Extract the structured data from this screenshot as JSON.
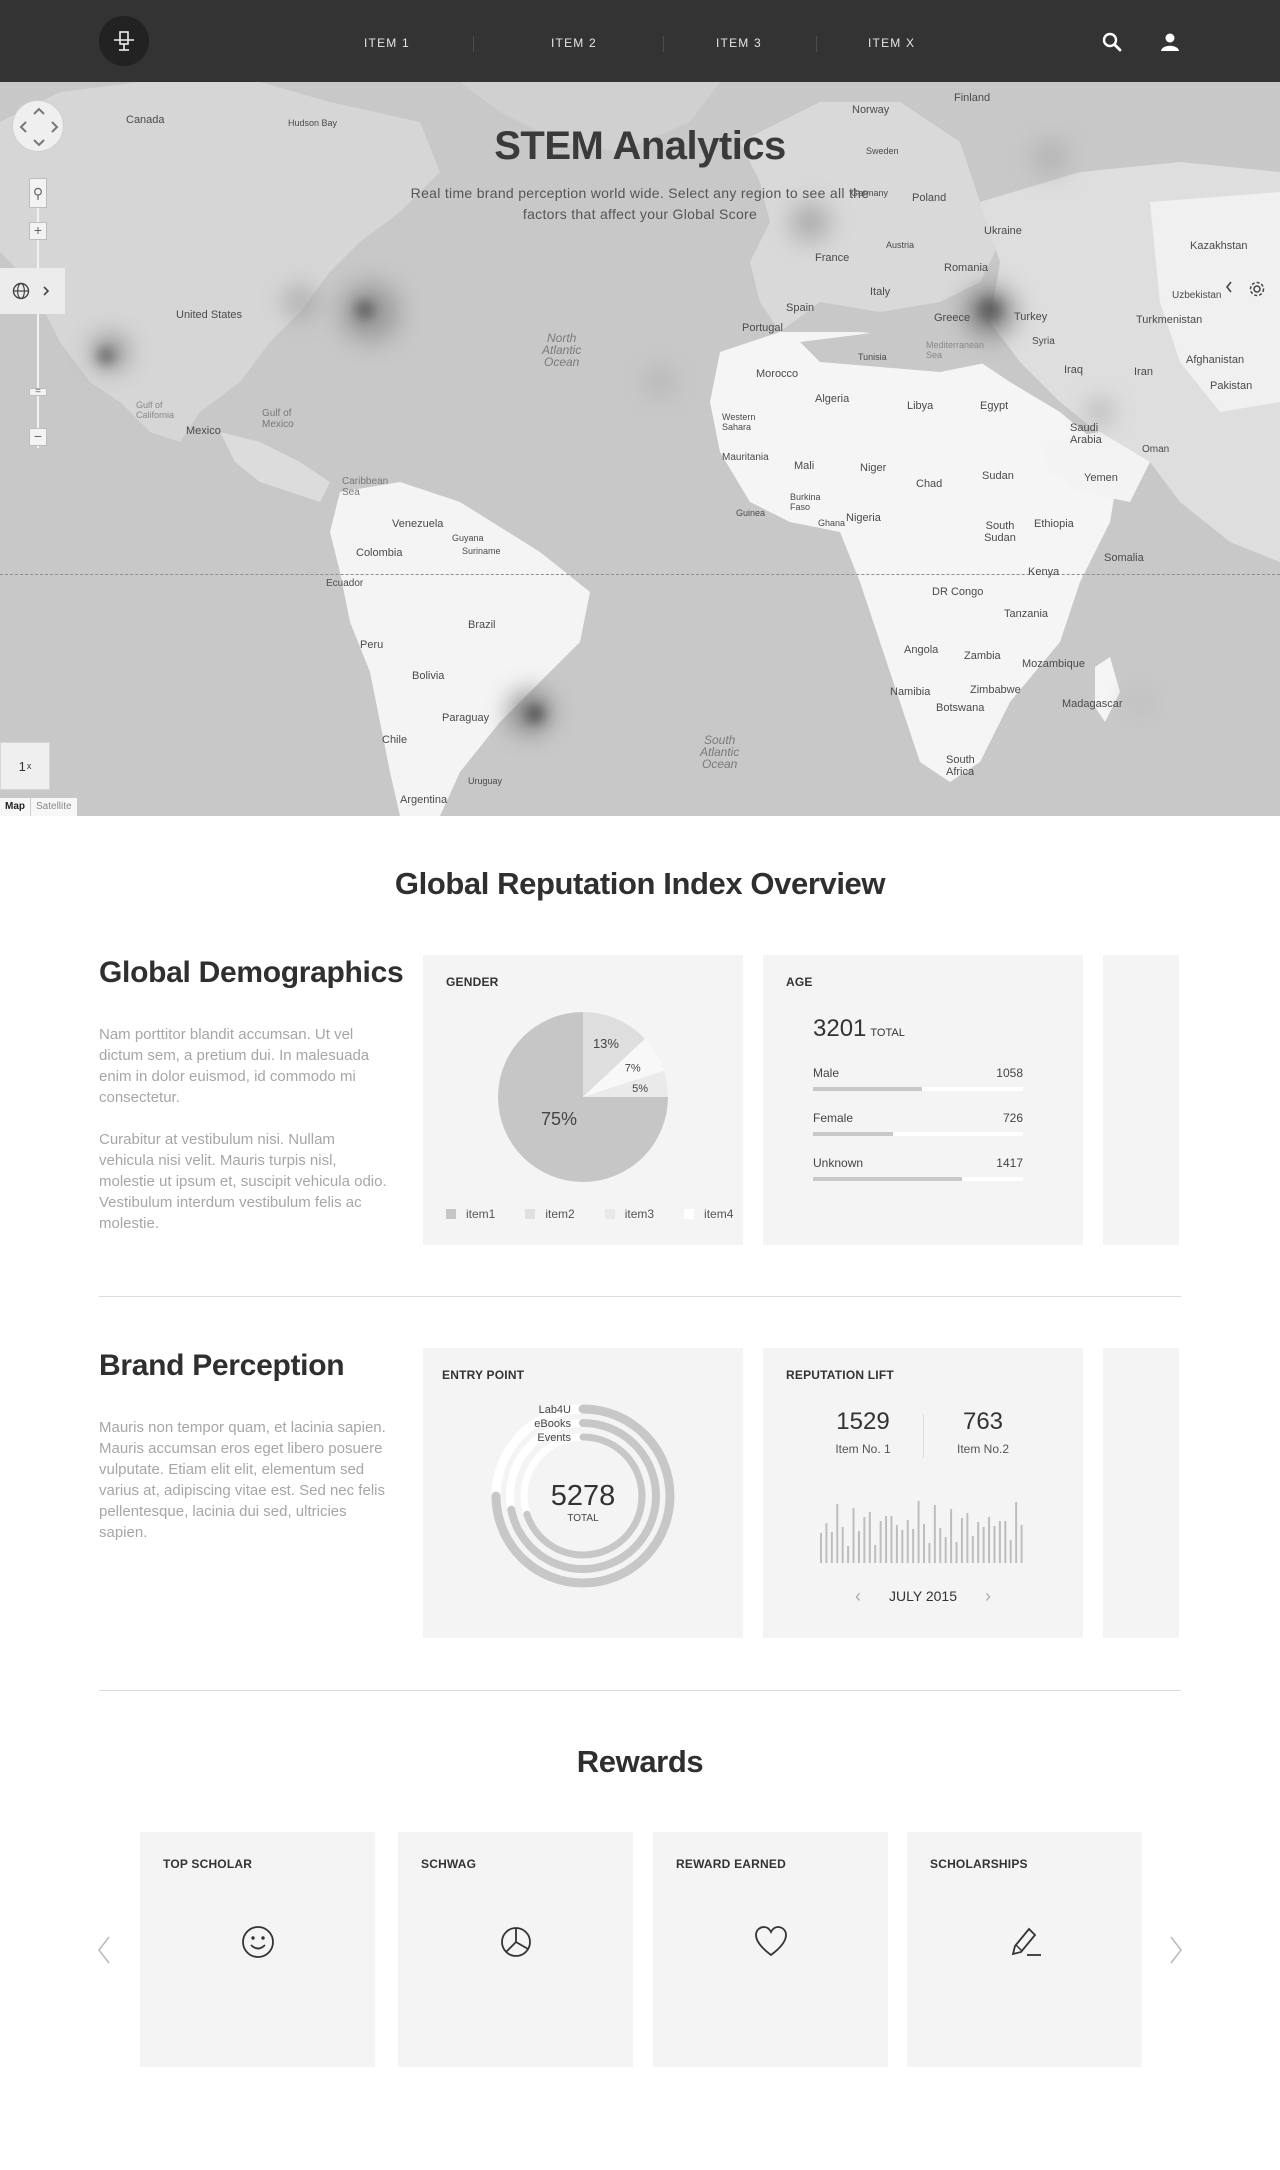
{
  "nav": {
    "items": [
      {
        "label": "ITEM 1"
      },
      {
        "label": "ITEM 2"
      },
      {
        "label": "ITEM 3"
      },
      {
        "label": "ITEM X"
      }
    ],
    "icons": {
      "logo": "logo-icon",
      "search": "search-icon",
      "user": "user-icon"
    }
  },
  "hero": {
    "title": "STEM Analytics",
    "subtitle": "Real time brand perception world wide. Select any region to see all the factors that affect your Global Score"
  },
  "map": {
    "speed_label": "1",
    "speed_unit": "x",
    "type_map": "Map",
    "type_satellite": "Satellite",
    "labels": [
      {
        "text": "Canada"
      },
      {
        "text": "Hudson Bay"
      },
      {
        "text": "United States"
      },
      {
        "text": "Mexico"
      },
      {
        "text": "Gulf of Mexico"
      },
      {
        "text": "Caribbean Sea"
      },
      {
        "text": "Venezuela"
      },
      {
        "text": "Colombia"
      },
      {
        "text": "Guyana"
      },
      {
        "text": "Suriname"
      },
      {
        "text": "Ecuador"
      },
      {
        "text": "Peru"
      },
      {
        "text": "Brazil"
      },
      {
        "text": "Bolivia"
      },
      {
        "text": "Paraguay"
      },
      {
        "text": "Chile"
      },
      {
        "text": "Argentina"
      },
      {
        "text": "Uruguay"
      },
      {
        "text": "Finland"
      },
      {
        "text": "Norway"
      },
      {
        "text": "Sweden"
      },
      {
        "text": "Poland"
      },
      {
        "text": "Ukraine"
      },
      {
        "text": "Germany"
      },
      {
        "text": "France"
      },
      {
        "text": "Spain"
      },
      {
        "text": "Portugal"
      },
      {
        "text": "Italy"
      },
      {
        "text": "Austria"
      },
      {
        "text": "Romania"
      },
      {
        "text": "Greece"
      },
      {
        "text": "Turkey"
      },
      {
        "text": "Kazakhstan"
      },
      {
        "text": "Uzbekistan"
      },
      {
        "text": "Turkmenistan"
      },
      {
        "text": "Afghanistan"
      },
      {
        "text": "Pakistan"
      },
      {
        "text": "Iraq"
      },
      {
        "text": "Iran"
      },
      {
        "text": "Syria"
      },
      {
        "text": "Saudi Arabia"
      },
      {
        "text": "Oman"
      },
      {
        "text": "Yemen"
      },
      {
        "text": "Egypt"
      },
      {
        "text": "Libya"
      },
      {
        "text": "Tunisia"
      },
      {
        "text": "Morocco"
      },
      {
        "text": "Algeria"
      },
      {
        "text": "Western Sahara"
      },
      {
        "text": "Mauritania"
      },
      {
        "text": "Mali"
      },
      {
        "text": "Niger"
      },
      {
        "text": "Chad"
      },
      {
        "text": "Sudan"
      },
      {
        "text": "South Sudan"
      },
      {
        "text": "Ethiopia"
      },
      {
        "text": "Somalia"
      },
      {
        "text": "Kenya"
      },
      {
        "text": "Nigeria"
      },
      {
        "text": "Burkina Faso"
      },
      {
        "text": "Guinea"
      },
      {
        "text": "Ghana"
      },
      {
        "text": "DR Congo"
      },
      {
        "text": "Tanzania"
      },
      {
        "text": "Angola"
      },
      {
        "text": "Zambia"
      },
      {
        "text": "Mozambique"
      },
      {
        "text": "Namibia"
      },
      {
        "text": "Botswana"
      },
      {
        "text": "Zimbabwe"
      },
      {
        "text": "Madagascar"
      },
      {
        "text": "South Africa"
      },
      {
        "text": "Mediterranean Sea"
      },
      {
        "text": "Gulf of California"
      }
    ],
    "oceans": [
      {
        "line1": "North",
        "line2": "Atlantic",
        "line3": "Ocean"
      },
      {
        "line1": "South",
        "line2": "Atlantic",
        "line3": "Ocean"
      }
    ]
  },
  "overview": {
    "title": "Global Reputation Index Overview"
  },
  "demographics": {
    "title": "Global Demographics",
    "para1": "Nam porttitor blandit accumsan. Ut vel dictum sem, a pretium dui. In malesuada enim in dolor euismod, id commodo mi consectetur.",
    "para2": "Curabitur at vestibulum nisi. Nullam vehicula nisi velit. Mauris turpis nisl, molestie ut ipsum et, suscipit vehicula odio. Vestibulum interdum vestibulum felis ac molestie.",
    "gender_card": {
      "label": "GENDER",
      "slices": [
        {
          "name": "item1",
          "value": 75,
          "label": "75%",
          "color": "#c6c6c6"
        },
        {
          "name": "item2",
          "value": 13,
          "label": "13%",
          "color": "#dedede"
        },
        {
          "name": "item3",
          "value": 7,
          "label": "7%",
          "color": "#f8f8f8"
        },
        {
          "name": "item4",
          "value": 5,
          "label": "5%",
          "color": "#eaeaea"
        }
      ],
      "legend": [
        {
          "name": "item1",
          "color": "#c6c6c6"
        },
        {
          "name": "item2",
          "color": "#e0e0e0"
        },
        {
          "name": "item3",
          "color": "#e8e8e8"
        },
        {
          "name": "item4",
          "color": "#ffffff"
        }
      ]
    },
    "age_card": {
      "label": "AGE",
      "total": "3201",
      "total_label": "TOTAL",
      "rows": [
        {
          "label": "Male",
          "value": "1058",
          "fraction": 0.52
        },
        {
          "label": "Female",
          "value": "726",
          "fraction": 0.38
        },
        {
          "label": "Unknown",
          "value": "1417",
          "fraction": 0.71
        }
      ]
    }
  },
  "brand": {
    "title": "Brand Perception",
    "para": "Mauris non tempor quam, et lacinia sapien. Mauris accumsan eros eget libero posuere vulputate. Etiam elit elit, elementum sed varius at, adipiscing vitae est. Sed nec felis pellentesque, lacinia dui sed, ultricies sapien.",
    "entry_card": {
      "label": "ENTRY POINT",
      "total": "5278",
      "total_label": "TOTAL",
      "rings": [
        {
          "name": "Lab4U",
          "fraction": 0.75
        },
        {
          "name": "eBooks",
          "fraction": 0.72
        },
        {
          "name": "Events",
          "fraction": 0.7
        }
      ]
    },
    "rep_card": {
      "label": "REPUTATION LIFT",
      "item1_value": "1529",
      "item1_label": "Item No. 1",
      "item2_value": "763",
      "item2_label": "Item No.2",
      "month": "JULY 2015",
      "prev_icon": "chevron-left-icon",
      "next_icon": "chevron-right-icon"
    }
  },
  "rewards": {
    "title": "Rewards",
    "cards": [
      {
        "label": "TOP SCHOLAR",
        "icon": "smiley-icon"
      },
      {
        "label": "SCHWAG",
        "icon": "pie-icon"
      },
      {
        "label": "REWARD EARNED",
        "icon": "heart-icon"
      },
      {
        "label": "SCHOLARSHIPS",
        "icon": "pencil-icon"
      }
    ],
    "prev_icon": "chevron-left-icon",
    "next_icon": "chevron-right-icon"
  }
}
